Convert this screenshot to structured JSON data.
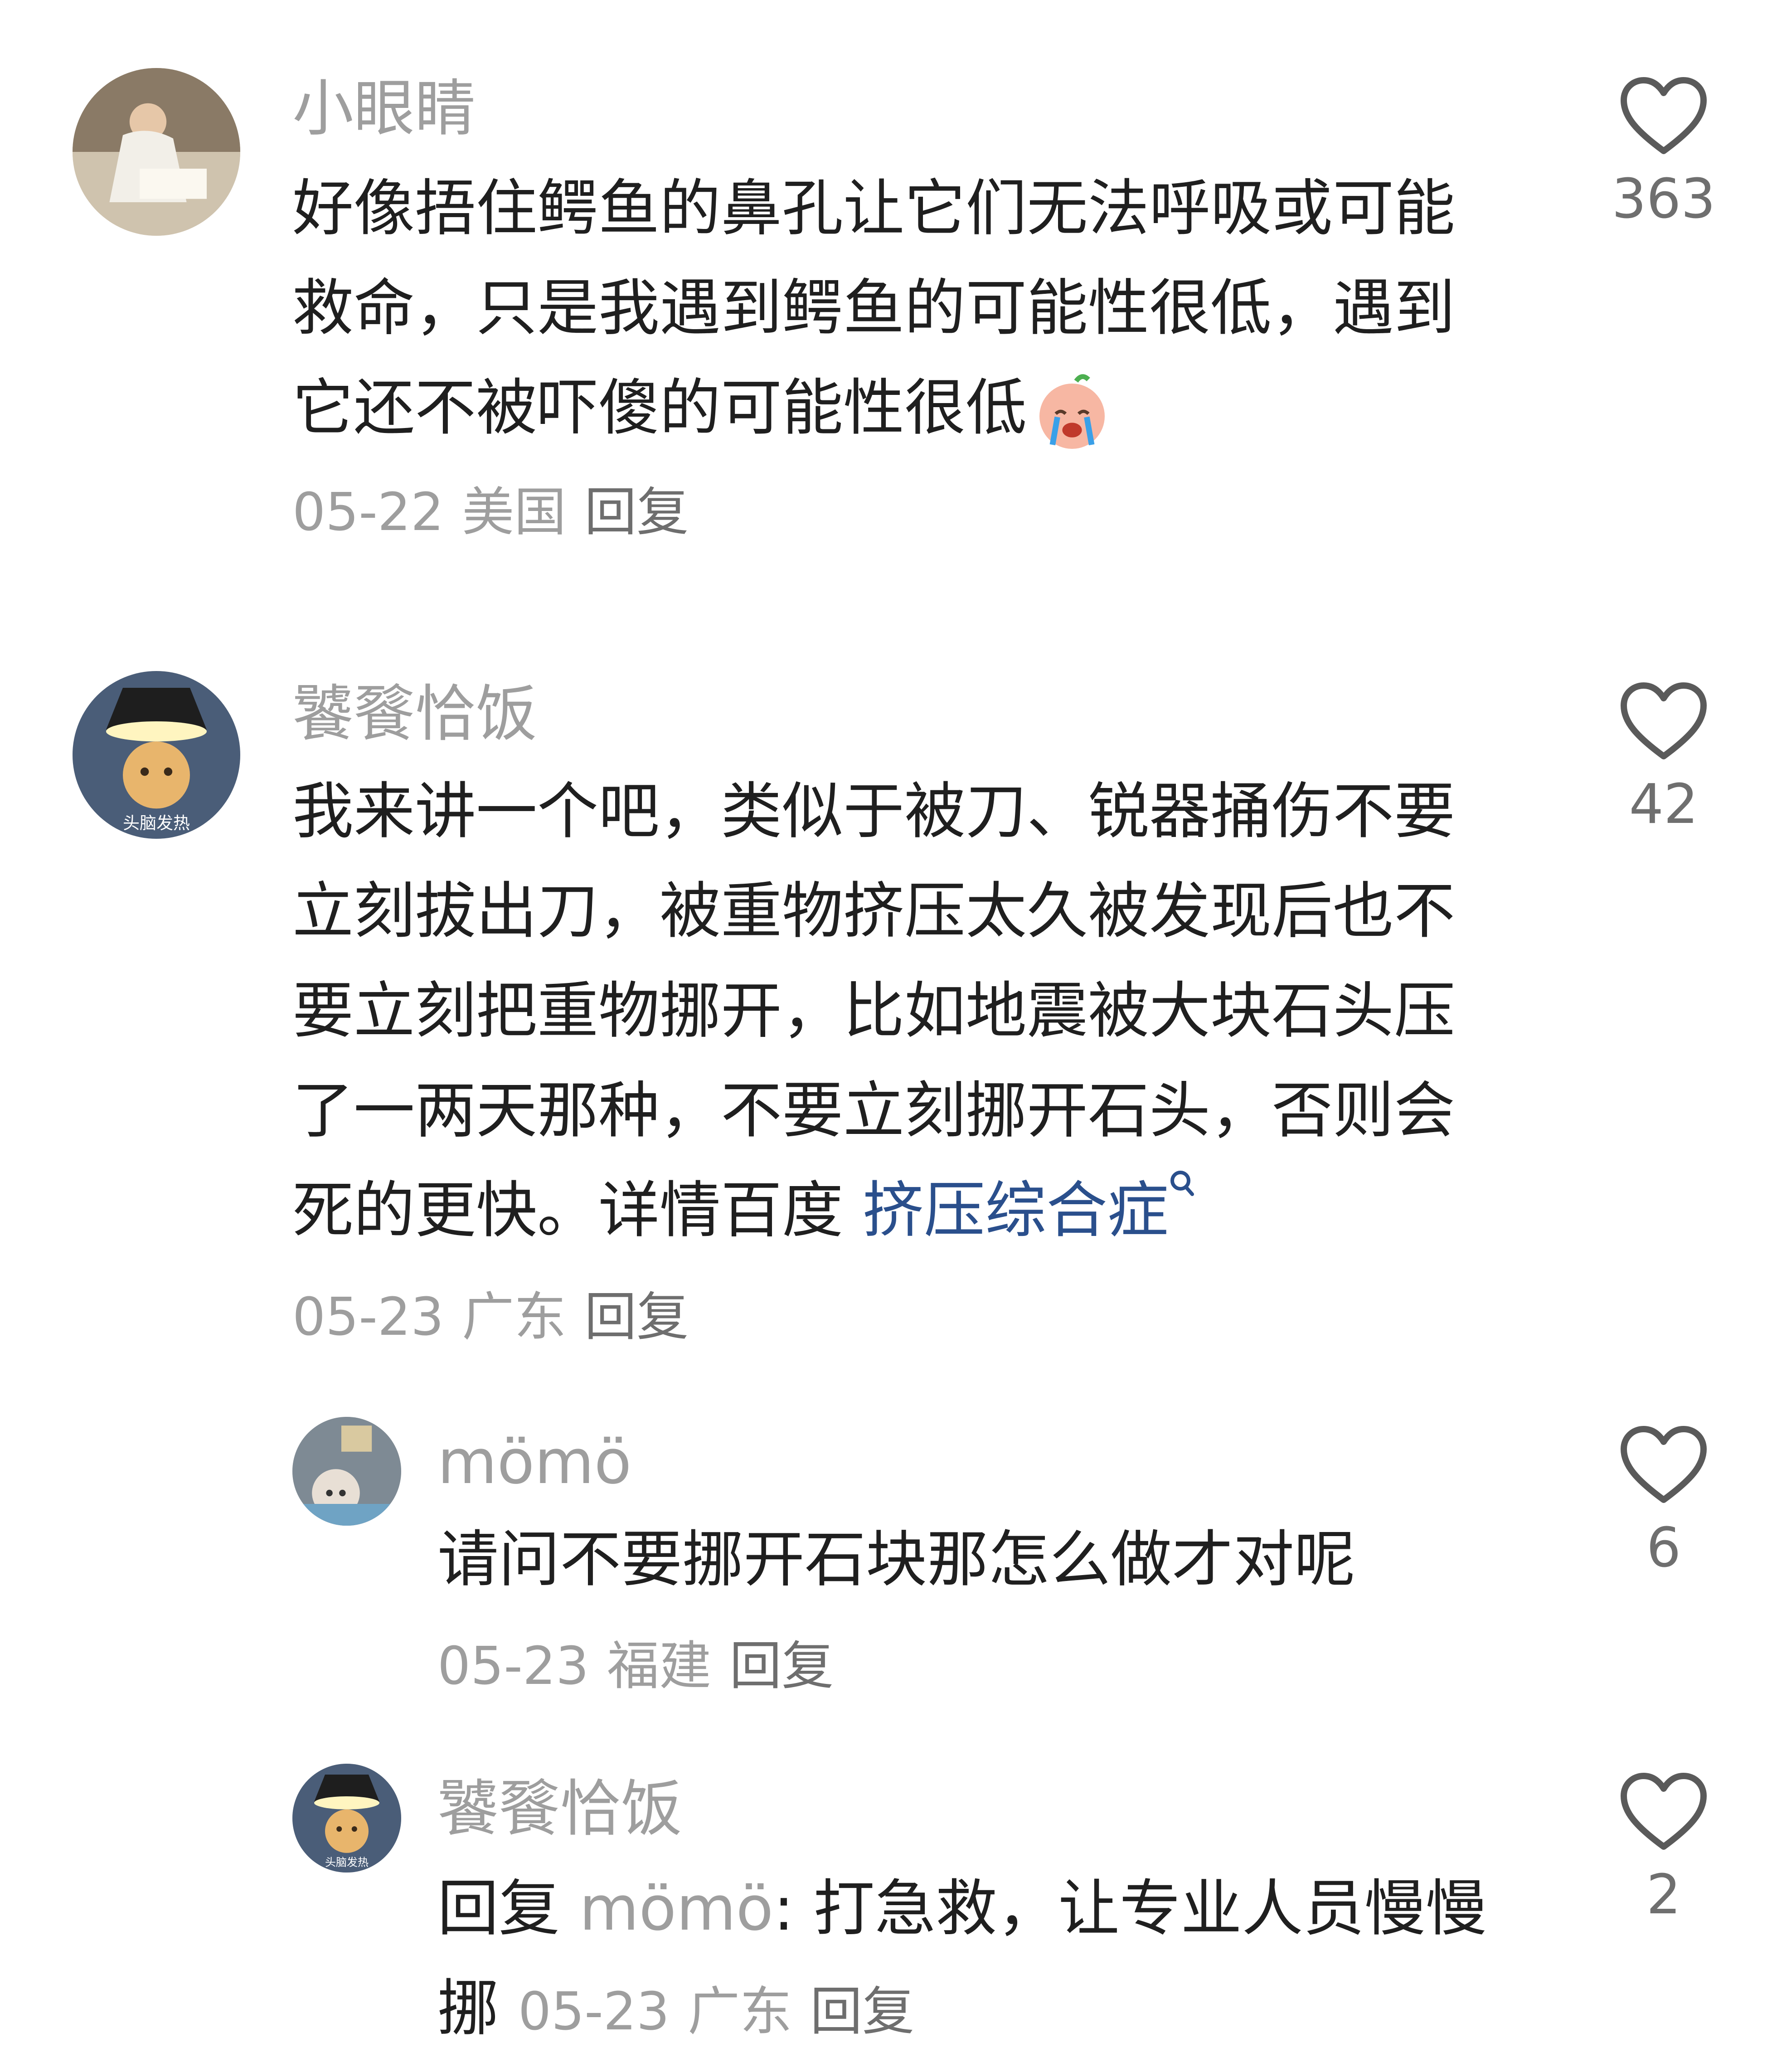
{
  "comments": [
    {
      "author": "小眼睛",
      "lines": [
        "好像捂住鳄鱼的鼻孔让它们无法呼吸或可能",
        "救命，只是我遇到鳄鱼的可能性很低，遇到",
        "它还不被吓傻的可能性很低"
      ],
      "date": "05-22",
      "location": "美国",
      "reply_label": "回复",
      "likes": "363",
      "emoji": "crying-face-emoji"
    },
    {
      "author": "饕餮恰饭",
      "lines": [
        "我来讲一个吧，类似于被刀、锐器捅伤不要",
        "立刻拔出刀，被重物挤压太久被发现后也不",
        "要立刻把重物挪开，比如地震被大块石头压",
        "了一两天那种，不要立刻挪开石头，否则会",
        "死的更快。详情百度 "
      ],
      "search_link": "挤压综合症",
      "date": "05-23",
      "location": "广东",
      "reply_label": "回复",
      "likes": "42",
      "avatar_text": "头脑发热"
    },
    {
      "author": "mömö",
      "lines": [
        "请问不要挪开石块那怎么做才对呢"
      ],
      "date": "05-23",
      "location": "福建",
      "reply_label": "回复",
      "likes": "6"
    },
    {
      "author": "饕餮恰饭",
      "reply_prefix": "回复 ",
      "reply_target": "mömö",
      "lines": [
        ": 打急救，让专业人员慢慢",
        "挪 "
      ],
      "date": "05-23",
      "location": "广东",
      "reply_label": "回复",
      "likes": "2",
      "avatar_text": "头脑发热"
    }
  ],
  "colors": {
    "author": "#9e9e9e",
    "text": "#1f1f1f",
    "meta": "#9e9e9e",
    "link": "#2a4f8c",
    "heart": "#5a5a5a"
  },
  "icons": {
    "like": "heart-outline-icon",
    "search": "search-icon"
  }
}
